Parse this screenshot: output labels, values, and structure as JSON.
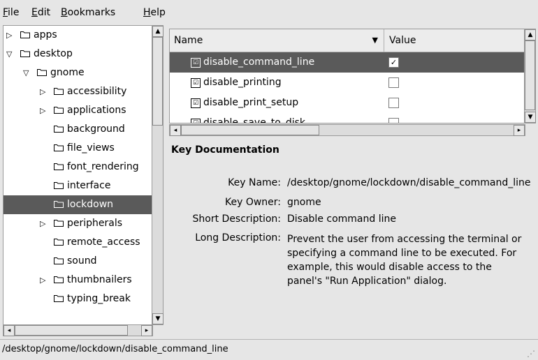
{
  "menu": {
    "file": {
      "u": "F",
      "rest": "ile"
    },
    "edit": {
      "u": "E",
      "rest": "dit"
    },
    "bookmarks": {
      "u": "B",
      "rest": "ookmarks"
    },
    "help": {
      "u": "H",
      "rest": "elp"
    }
  },
  "tree": {
    "items": [
      {
        "label": "apps",
        "expander": "▷"
      },
      {
        "label": "desktop",
        "expander": "▽"
      },
      {
        "label": "gnome",
        "expander": "▽"
      },
      {
        "label": "accessibility",
        "expander": "▷"
      },
      {
        "label": "applications",
        "expander": "▷"
      },
      {
        "label": "background",
        "expander": ""
      },
      {
        "label": "file_views",
        "expander": ""
      },
      {
        "label": "font_rendering",
        "expander": ""
      },
      {
        "label": "interface",
        "expander": ""
      },
      {
        "label": "lockdown",
        "expander": ""
      },
      {
        "label": "peripherals",
        "expander": "▷"
      },
      {
        "label": "remote_access",
        "expander": ""
      },
      {
        "label": "sound",
        "expander": ""
      },
      {
        "label": "thumbnailers",
        "expander": "▷"
      },
      {
        "label": "typing_break",
        "expander": ""
      }
    ]
  },
  "list": {
    "columns": {
      "name": "Name",
      "value": "Value"
    },
    "rows": [
      {
        "name": "disable_command_line",
        "checked": "✓"
      },
      {
        "name": "disable_printing",
        "checked": ""
      },
      {
        "name": "disable_print_setup",
        "checked": ""
      },
      {
        "name": "disable_save_to_disk",
        "checked": ""
      }
    ]
  },
  "doc": {
    "heading": "Key Documentation",
    "key_name_label": "Key Name:",
    "key_name": "/desktop/gnome/lockdown/disable_command_line",
    "key_owner_label": "Key Owner:",
    "key_owner": "gnome",
    "short_desc_label": "Short Description:",
    "short_desc": "Disable command line",
    "long_desc_label": "Long Description:",
    "long_desc_lines": [
      "Prevent the user from accessing the terminal or",
      "specifying a command line to be executed. For",
      "example, this would disable access to the",
      "panel's \"Run Application\" dialog."
    ]
  },
  "status": {
    "path": "/desktop/gnome/lockdown/disable_command_line"
  },
  "colors": {
    "selection": "#5a5a5a"
  }
}
